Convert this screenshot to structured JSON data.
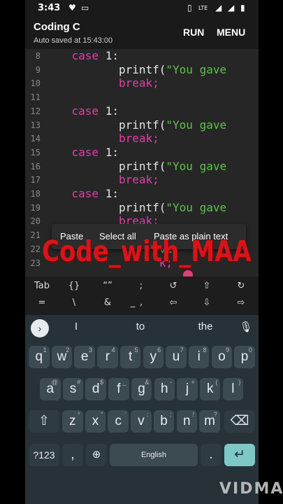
{
  "status": {
    "time": "3:43",
    "signal_label": "LTE"
  },
  "appbar": {
    "title": "Coding C",
    "subtitle": "Auto saved at 15:43:00",
    "run": "RUN",
    "menu": "MENU"
  },
  "editor": {
    "lines": [
      {
        "num": "8",
        "keyword": "case",
        "rest": " 1:",
        "indent": "    "
      },
      {
        "num": "9",
        "fn": "printf(",
        "str": "\"You gave",
        "indent": "           "
      },
      {
        "num": "10",
        "brk": "break;",
        "indent": "           "
      },
      {
        "num": "11"
      },
      {
        "num": "12",
        "keyword": "case",
        "rest": " 1:",
        "indent": "    "
      },
      {
        "num": "13",
        "fn": "printf(",
        "str": "\"You gave",
        "indent": "           "
      },
      {
        "num": "14",
        "brk": "break;",
        "indent": "           "
      },
      {
        "num": "15",
        "keyword": "case",
        "rest": " 1:",
        "indent": "    "
      },
      {
        "num": "16",
        "fn": "printf(",
        "str": "\"You gave",
        "indent": "           "
      },
      {
        "num": "17",
        "brk": "break;",
        "indent": "           "
      },
      {
        "num": "18",
        "keyword": "case",
        "rest": " 1:",
        "indent": "    "
      },
      {
        "num": "19",
        "fn": "printf(",
        "str": "\"You gave",
        "indent": "           "
      },
      {
        "num": "20",
        "brk": "break;",
        "indent": "           "
      },
      {
        "num": "21"
      },
      {
        "num": "22",
        "str": "ve",
        "indent": "                 "
      },
      {
        "num": "23",
        "brk": "k;",
        "indent": "                 "
      }
    ]
  },
  "context_menu": {
    "paste": "Paste",
    "select_all": "Select all",
    "paste_plain": "Paste as plain text"
  },
  "watermark": "Code_with_MAA",
  "symbols": {
    "row1": [
      "Tab",
      "{}",
      "“”",
      ";",
      "↺",
      "⇧",
      "↻"
    ],
    "row2": [
      "=",
      "\\",
      "&",
      "_",
      ",",
      "⇦",
      "⇩",
      "⇨"
    ]
  },
  "keyboard": {
    "suggestions": [
      "I",
      "to",
      "the"
    ],
    "row1": [
      {
        "k": "q",
        "h": "1"
      },
      {
        "k": "w",
        "h": "2"
      },
      {
        "k": "e",
        "h": "3"
      },
      {
        "k": "r",
        "h": "4"
      },
      {
        "k": "t",
        "h": "5"
      },
      {
        "k": "y",
        "h": "6"
      },
      {
        "k": "u",
        "h": "7"
      },
      {
        "k": "i",
        "h": "8"
      },
      {
        "k": "o",
        "h": "9"
      },
      {
        "k": "p",
        "h": "0"
      }
    ],
    "row2": [
      {
        "k": "a",
        "h": "@"
      },
      {
        "k": "s",
        "h": "#"
      },
      {
        "k": "d",
        "h": "$"
      },
      {
        "k": "f",
        "h": "_"
      },
      {
        "k": "g",
        "h": "&"
      },
      {
        "k": "h",
        "h": "-"
      },
      {
        "k": "j",
        "h": "+"
      },
      {
        "k": "k",
        "h": "("
      },
      {
        "k": "l",
        "h": ")"
      }
    ],
    "row3": [
      {
        "k": "z",
        "h": "*"
      },
      {
        "k": "x",
        "h": "\""
      },
      {
        "k": "c",
        "h": "'"
      },
      {
        "k": "v",
        "h": ":"
      },
      {
        "k": "b",
        "h": ";"
      },
      {
        "k": "n",
        "h": "!"
      },
      {
        "k": "m",
        "h": "?"
      }
    ],
    "numbers_key": "?123",
    "comma_key": ",",
    "space_label": "English",
    "period_key": "."
  },
  "corner_watermark": "VIDMA",
  "colors": {
    "keyword": "#e040a8",
    "string": "#5cc24a",
    "keyboard_bg": "#263238",
    "enter_key": "#7fc8c8"
  }
}
